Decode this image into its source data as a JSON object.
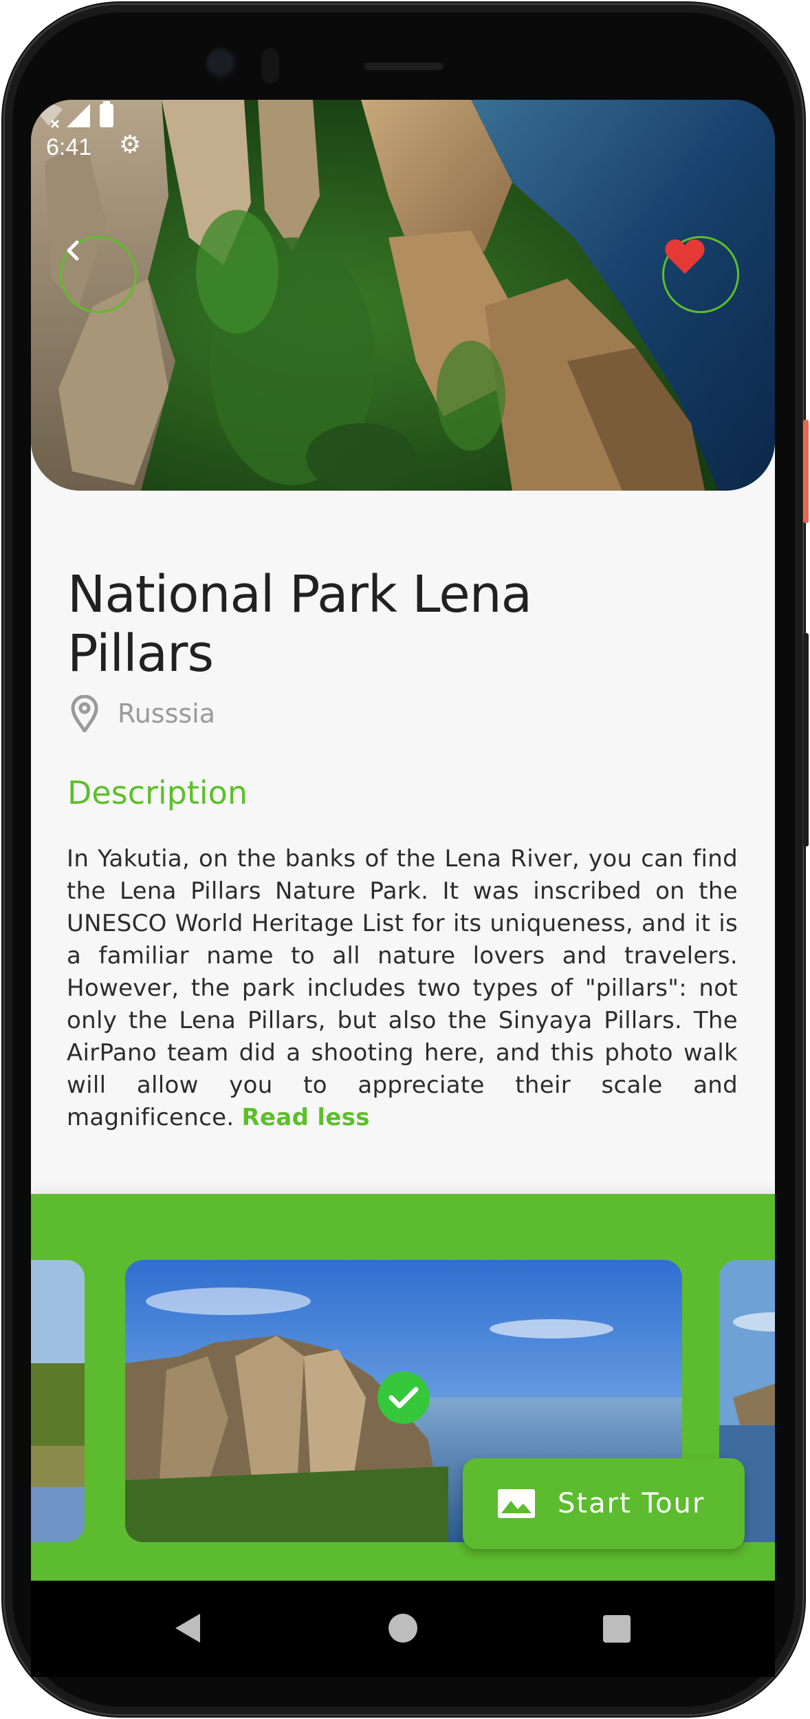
{
  "status_bar": {
    "time": "6:41",
    "icons": [
      "settings-icon",
      "wifi-off-icon",
      "signal-icon",
      "battery-icon"
    ]
  },
  "header": {
    "back_icon": "chevron-left-icon",
    "favorite_icon": "heart-icon",
    "favorite_active": true
  },
  "place": {
    "title": "National Park Lena Pillars",
    "location": "Russsia",
    "location_icon": "location-pin-icon"
  },
  "description": {
    "heading": "Description",
    "body": "In Yakutia, on the banks of the Lena River, you can find the Lena Pillars Nature Park. It was inscribed on the UNESCO World Heritage List for its uniqueness, and it is a familiar name to all nature lovers and travelers. However, the park includes two types of \"pillars\": not only the Lena Pillars, but also the Sinyaya Pillars. The AirPano team did a shooting here, and this photo walk will allow you to appreciate their scale and magnificence.",
    "toggle_label": "Read less"
  },
  "gallery": {
    "selected_icon": "checkmark-icon",
    "start_tour_label": "Start Tour",
    "start_tour_icon": "landscape-image-icon"
  },
  "nav": {
    "icons": [
      "nav-back-icon",
      "nav-home-icon",
      "nav-recents-icon"
    ]
  },
  "colors": {
    "accent": "#5cbf2a",
    "badge": "#35c83a",
    "heart": "#e53935",
    "title": "#212121",
    "muted": "#9a9a9a"
  }
}
